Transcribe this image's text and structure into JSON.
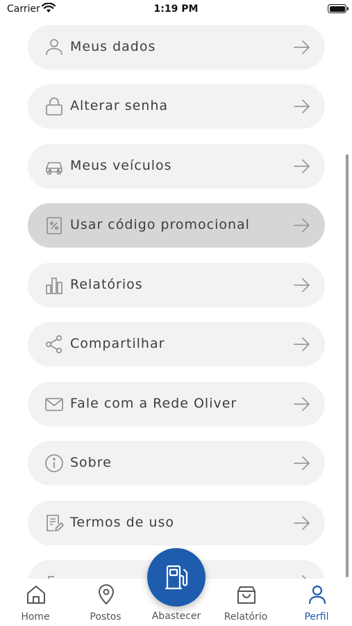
{
  "status_bar": {
    "carrier": "Carrier",
    "time": "1:19 PM"
  },
  "menu": {
    "items": [
      {
        "label": "Meus dados",
        "icon": "user-icon"
      },
      {
        "label": "Alterar senha",
        "icon": "lock-icon"
      },
      {
        "label": "Meus veículos",
        "icon": "car-icon"
      },
      {
        "label": "Usar código promocional",
        "icon": "percent-icon",
        "selected": true
      },
      {
        "label": "Relatórios",
        "icon": "bar-chart-icon"
      },
      {
        "label": "Compartilhar",
        "icon": "share-icon"
      },
      {
        "label": "Fale com a Rede Oliver",
        "icon": "mail-icon"
      },
      {
        "label": "Sobre",
        "icon": "info-icon"
      },
      {
        "label": "Termos de uso",
        "icon": "document-icon"
      }
    ]
  },
  "tab_bar": {
    "home": "Home",
    "postos": "Postos",
    "abastecer": "Abastecer",
    "relatorio": "Relatório",
    "perfil": "Perfil",
    "active": "perfil"
  },
  "colors": {
    "accent": "#1e5cae",
    "item_bg": "#f2f2f2",
    "item_selected_bg": "#d6d6d6",
    "text": "#3d3d3d"
  }
}
